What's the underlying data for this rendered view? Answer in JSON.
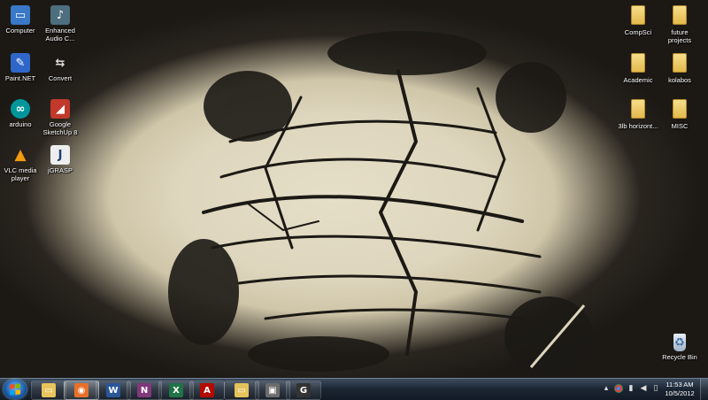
{
  "desktop": {
    "left_icons": [
      {
        "label": "Computer",
        "icon": "computer-icon"
      },
      {
        "label": "Enhanced Audio C...",
        "icon": "enhanced-audio-icon"
      },
      {
        "label": "Paint.NET",
        "icon": "paint-net-icon"
      },
      {
        "label": "Convert",
        "icon": "convert-icon"
      },
      {
        "label": "arduino",
        "icon": "arduino-icon"
      },
      {
        "label": "Google SketchUp 8",
        "icon": "sketchup-icon"
      },
      {
        "label": "VLC media player",
        "icon": "vlc-icon"
      },
      {
        "label": "jGRASP",
        "icon": "jgrasp-icon"
      }
    ],
    "right_icons": [
      {
        "label": "CompSci",
        "icon": "folder-icon"
      },
      {
        "label": "future projects",
        "icon": "folder-icon"
      },
      {
        "label": "Academic",
        "icon": "folder-icon"
      },
      {
        "label": "kolabos",
        "icon": "folder-icon"
      },
      {
        "label": "3lb horizont...",
        "icon": "folder-icon"
      },
      {
        "label": "MISC",
        "icon": "folder-icon"
      }
    ],
    "recycle_bin": {
      "label": "Recycle Bin",
      "icon": "recycle-bin-icon"
    }
  },
  "taskbar": {
    "start_icon": "windows-start-icon",
    "items": [
      {
        "icon": "file-explorer-icon",
        "glyph": "▭",
        "color": "#e8c45a"
      },
      {
        "icon": "firefox-icon",
        "glyph": "◉",
        "color": "#e8702a",
        "active": true
      },
      {
        "icon": "word-icon",
        "glyph": "W",
        "color": "#2b579a"
      },
      {
        "icon": "onenote-icon",
        "glyph": "N",
        "color": "#80397b"
      },
      {
        "icon": "excel-icon",
        "glyph": "X",
        "color": "#217346"
      },
      {
        "icon": "acrobat-icon",
        "glyph": "A",
        "color": "#b30b00"
      },
      {
        "icon": "folder-window-icon",
        "glyph": "▭",
        "color": "#e3c35a"
      },
      {
        "icon": "media-center-icon",
        "glyph": "▣",
        "color": "#6c6c6c"
      },
      {
        "icon": "g-app-icon",
        "glyph": "G",
        "color": "#333333"
      }
    ],
    "tray": {
      "icons": [
        "show-hidden-icons-arrow",
        "chrome-tray-icon",
        "network-signal-icon",
        "volume-icon",
        "power-icon"
      ],
      "time": "11:53 AM",
      "date": "10/5/2012"
    }
  }
}
